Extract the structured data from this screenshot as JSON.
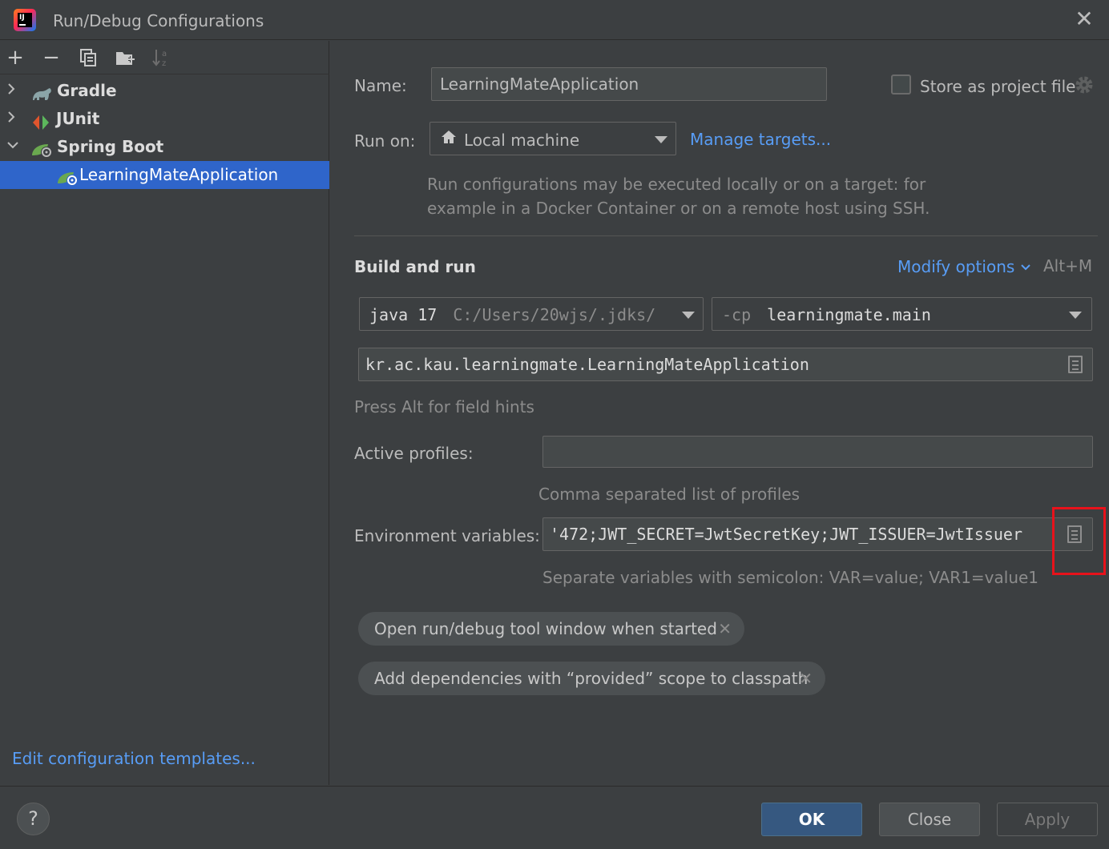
{
  "window": {
    "title": "Run/Debug Configurations",
    "close_glyph": "✕"
  },
  "toolbar": {
    "add": "+",
    "remove": "−"
  },
  "tree": {
    "items": [
      {
        "label": "Gradle",
        "expanded": false,
        "icon": "gradle-elephant-icon"
      },
      {
        "label": "JUnit",
        "expanded": false,
        "icon": "junit-icon"
      },
      {
        "label": "Spring Boot",
        "expanded": true,
        "icon": "spring-boot-icon"
      },
      {
        "label": "LearningMateApplication",
        "selected": true,
        "icon": "spring-boot-config-icon"
      }
    ],
    "edit_templates": "Edit configuration templates..."
  },
  "form": {
    "name_label": "Name:",
    "name_value": "LearningMateApplication",
    "store_label": "Store as project file",
    "run_on_label": "Run on:",
    "run_on_value": "Local machine",
    "manage_targets": "Manage targets...",
    "run_hint_line1": "Run configurations may be executed locally or on a target: for",
    "run_hint_line2": "example in a Docker Container or on a remote host using SSH.",
    "build_run_title": "Build and run",
    "modify_options": "Modify options",
    "modify_shortcut": "Alt+M",
    "jdk_version": "java 17",
    "jdk_path": "C:/Users/20wjs/.jdks/",
    "cp_flag": "-cp",
    "cp_value": "learningmate.main",
    "main_class": "kr.ac.kau.learningmate.LearningMateApplication",
    "field_hints": "Press Alt for field hints",
    "active_profiles_label": "Active profiles:",
    "active_profiles_value": "",
    "profiles_hint": "Comma separated list of profiles",
    "env_label": "Environment variables:",
    "env_value": "'472;JWT_SECRET=JwtSecretKey;JWT_ISSUER=JwtIssuer",
    "env_hint": "Separate variables with semicolon: VAR=value; VAR1=value1",
    "chip1": "Open run/debug tool window when started",
    "chip2": "Add dependencies with “provided” scope to classpath",
    "chip_close": "✕"
  },
  "footer": {
    "help": "?",
    "ok": "OK",
    "close": "Close",
    "apply": "Apply"
  },
  "colors": {
    "background": "#3c3f41",
    "selection": "#2f65ca",
    "link": "#589df6",
    "highlight": "#e8121b"
  }
}
